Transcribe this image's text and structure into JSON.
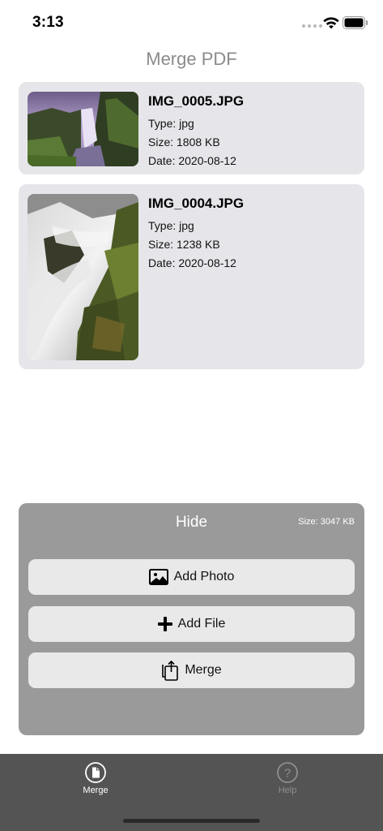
{
  "status_bar": {
    "time": "3:13"
  },
  "nav": {
    "title": "Merge PDF"
  },
  "files": [
    {
      "name": "IMG_0005.JPG",
      "type": "Type: jpg",
      "size": "Size: 1808 KB",
      "date": "Date: 2020-08-12",
      "thumbnail": "waterfall-landscape"
    },
    {
      "name": "IMG_0004.JPG",
      "type": "Type: jpg",
      "size": "Size: 1238 KB",
      "date": "Date: 2020-08-12",
      "thumbnail": "waterfall-closeup"
    }
  ],
  "panel": {
    "hide_label": "Hide",
    "total_size": "Size: 3047 KB",
    "add_photo_label": "Add Photo",
    "add_file_label": "Add File",
    "merge_label": "Merge"
  },
  "tabs": [
    {
      "label": "Merge",
      "icon": "document-icon",
      "active": true
    },
    {
      "label": "Help",
      "icon": "question-icon",
      "active": false
    }
  ],
  "colors": {
    "card_bg": "#e6e6ea",
    "panel_bg": "#9a9a9a",
    "button_bg": "#e9e9e9",
    "tab_bar_bg": "#545454"
  }
}
